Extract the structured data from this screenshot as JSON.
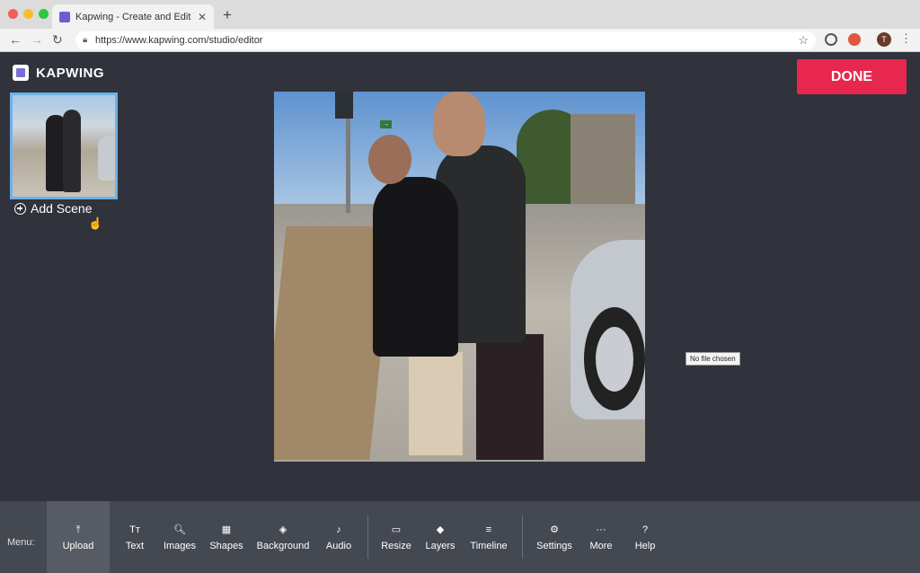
{
  "browser": {
    "tab_title": "Kapwing - Create and Edit Vide",
    "url": "https://www.kapwing.com/studio/editor",
    "avatar_initial": "T",
    "traffic_lights": [
      "#f25f57",
      "#f8bc2e",
      "#2ac740"
    ]
  },
  "app": {
    "brand": "KAPWING",
    "done_label": "DONE",
    "add_scene_label": "Add Scene",
    "tooltip": "No file chosen",
    "accent_color": "#e8274e",
    "selection_color": "#6fb1e8"
  },
  "toolbar": {
    "menu_label": "Menu:",
    "items": [
      {
        "label": "Upload",
        "icon": "upload-icon",
        "glyph": "⤒"
      },
      {
        "label": "Text",
        "icon": "text-icon",
        "glyph": "Tт"
      },
      {
        "label": "Images",
        "icon": "search-icon",
        "glyph": "🔍︎"
      },
      {
        "label": "Shapes",
        "icon": "shapes-icon",
        "glyph": "▦"
      },
      {
        "label": "Background",
        "icon": "paint-bucket-icon",
        "glyph": "◈"
      },
      {
        "label": "Audio",
        "icon": "music-note-icon",
        "glyph": "♪"
      },
      {
        "label": "Resize",
        "icon": "resize-icon",
        "glyph": "▭"
      },
      {
        "label": "Layers",
        "icon": "layers-icon",
        "glyph": "◆"
      },
      {
        "label": "Timeline",
        "icon": "timeline-icon",
        "glyph": "≡"
      },
      {
        "label": "Settings",
        "icon": "gear-icon",
        "glyph": "⚙"
      },
      {
        "label": "More",
        "icon": "more-icon",
        "glyph": "···"
      },
      {
        "label": "Help",
        "icon": "help-icon",
        "glyph": "?"
      }
    ]
  }
}
